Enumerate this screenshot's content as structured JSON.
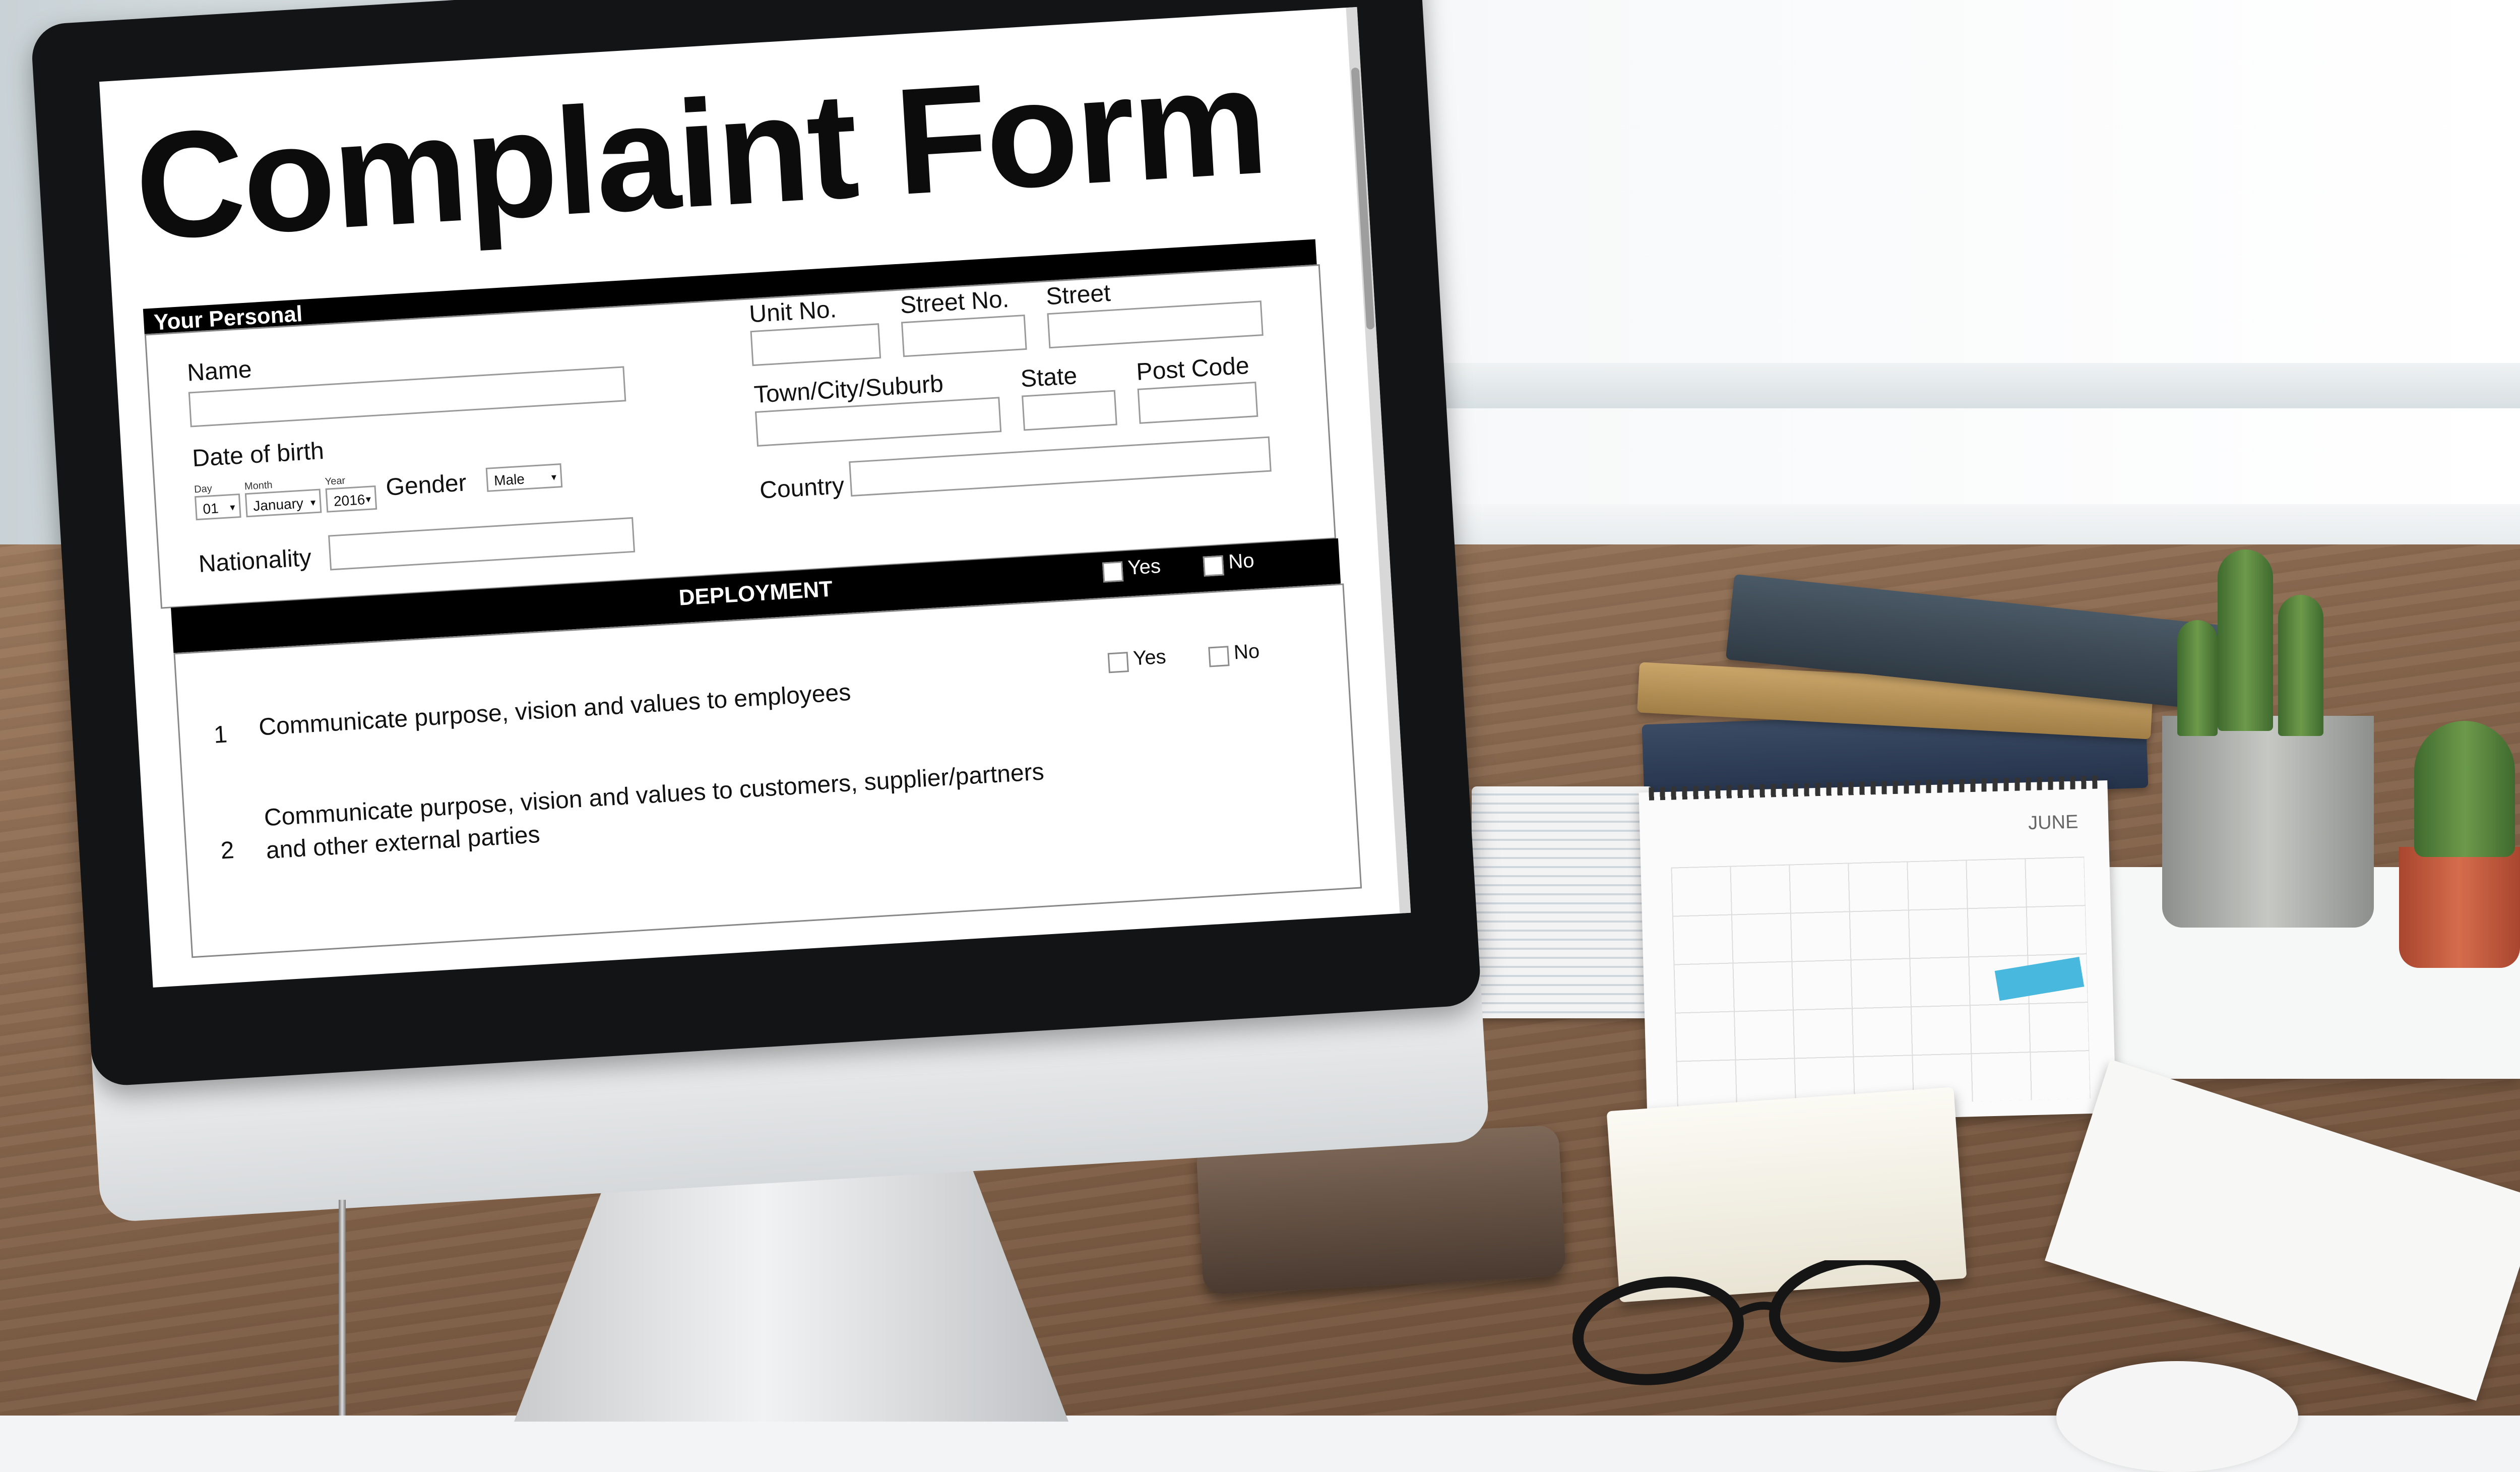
{
  "form": {
    "title": "Complaint Form",
    "personal_header": "Your Personal",
    "name_label": "Name",
    "dob_label": "Date of birth",
    "day_label": "Day",
    "month_label": "Month",
    "year_label": "Year",
    "day_value": "01",
    "month_value": "January",
    "year_value": "2016",
    "gender_label": "Gender",
    "gender_value": "Male",
    "nationality_label": "Nationality",
    "unit_label": "Unit No.",
    "street_no_label": "Street No.",
    "street_label": "Street",
    "town_label": "Town/City/Suburb",
    "state_label": "State",
    "postcode_label": "Post Code",
    "country_label": "Country",
    "deployment_header": "DEPLOYMENT",
    "yes_label": "Yes",
    "no_label": "No",
    "questions": [
      {
        "number": "1",
        "line1": "Communicate purpose, vision and values to employees",
        "line2": ""
      },
      {
        "number": "2",
        "line1": "Communicate purpose, vision and values to customers, supplier/partners",
        "line2": "and other external parties"
      }
    ]
  },
  "calendar": {
    "month": "JUNE"
  },
  "colors": {
    "bar": "#000000",
    "calendar_sticky": "#48b8de"
  }
}
